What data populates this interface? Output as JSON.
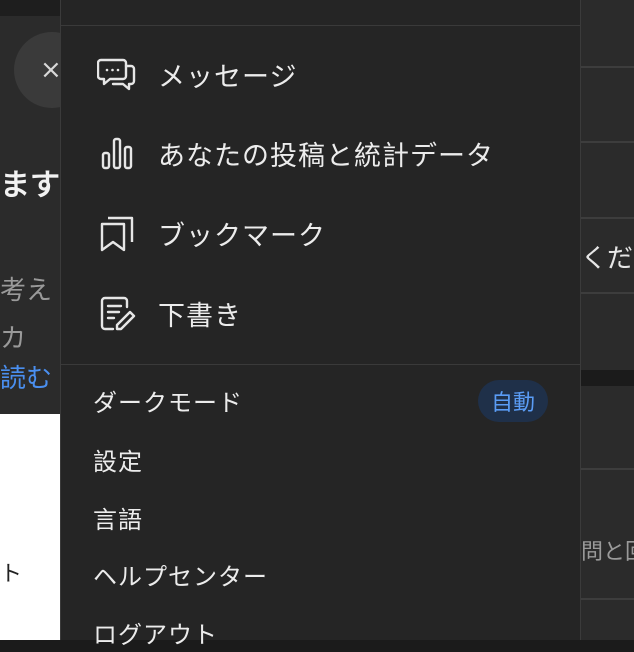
{
  "left_page": {
    "close_glyph": "×",
    "text_1": "ます",
    "text_2": "考え",
    "text_3": "カ",
    "text_4": "読む",
    "text_5": "ト"
  },
  "right_page": {
    "text_1": "くだ",
    "text_2": "問と回"
  },
  "menu": {
    "icon_items": [
      {
        "label": "メッセージ",
        "icon": "chat-bubbles-icon"
      },
      {
        "label": "あなたの投稿と統計データ",
        "icon": "bar-chart-icon"
      },
      {
        "label": "ブックマーク",
        "icon": "bookmark-icon"
      },
      {
        "label": "下書き",
        "icon": "draft-edit-icon"
      }
    ],
    "dark_mode": {
      "label": "ダークモード",
      "badge": "自動"
    },
    "settings": "設定",
    "language": "言語",
    "help_center": "ヘルプセンター",
    "logout": "ログアウト"
  },
  "colors": {
    "menu_bg": "#252525",
    "page_bg": "#2b2b2b",
    "accent": "#5a9cf5",
    "badge_bg": "#1f3049"
  }
}
